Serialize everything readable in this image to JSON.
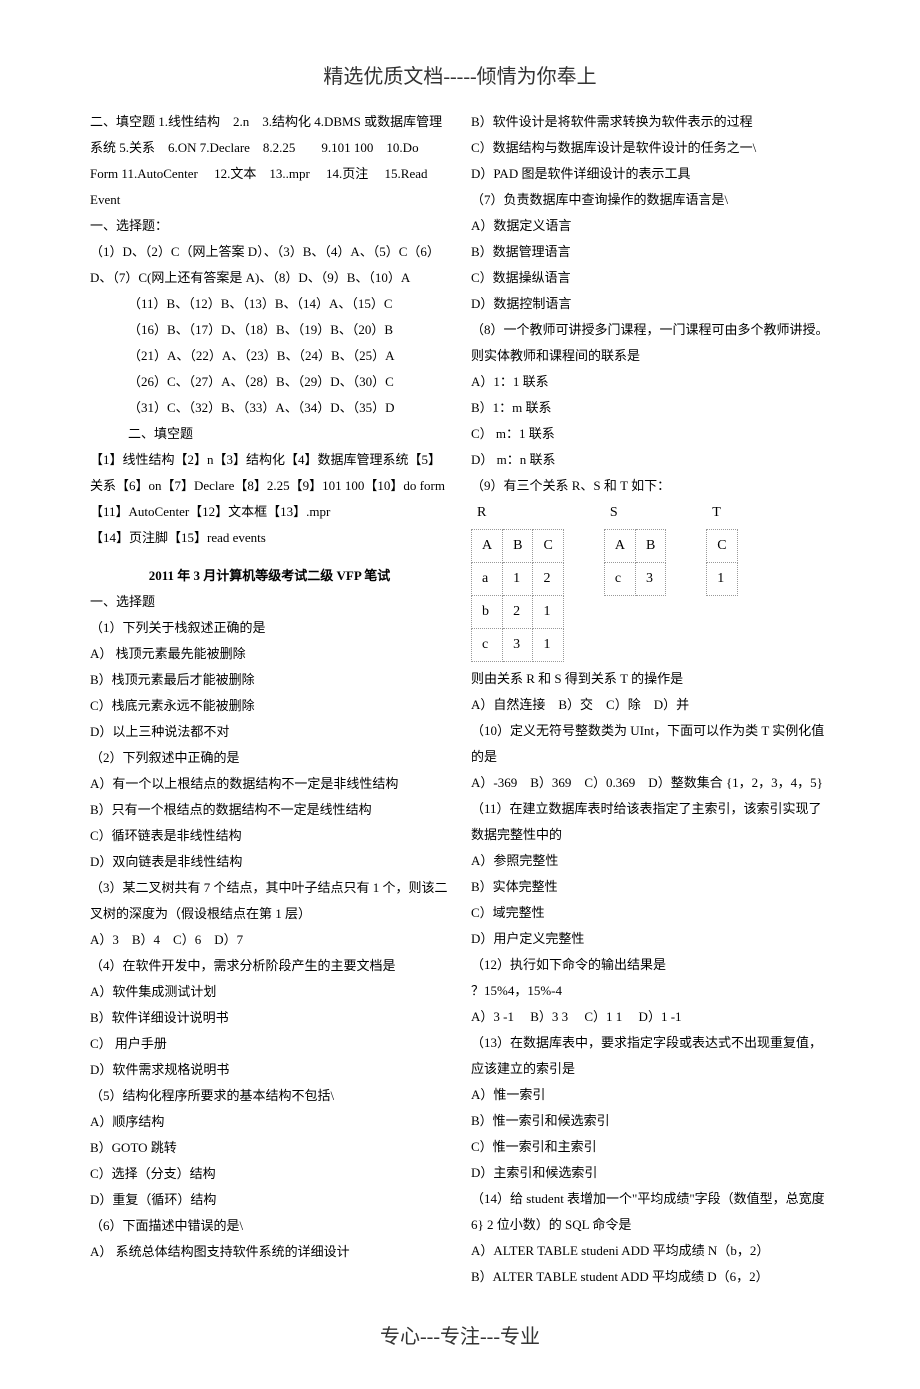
{
  "header": "精选优质文档-----倾情为你奉上",
  "footer": "专心---专注---专业",
  "left": {
    "p": [
      "二、填空题 1.线性结构　2.n　3.结构化 4.DBMS 或数据库管理系统 5.关系　6.ON 7.Declare　8.2.25　　9.101 100　10.Do Form 11.AutoCenter　 12.文本　13..mpr　 14.页注　 15.Read Event",
      "一、选择题：",
      "（1）D、（2）C（网上答案 D）、（3）B、（4）A、（5）C（6）D、（7）C(网上还有答案是 A)、（8）D、（9）B、（10）A"
    ],
    "indent": [
      "（11）B、（12）B、（13）B、（14）A、（15）C",
      "（16）B、（17）D、（18）B、（19）B、（20）B",
      "（21）A、（22）A、（23）B、（24）B、（25）A",
      "（26）C、（27）A、（28）B、（29）D、（30）C",
      "（31）C、（32）B、（33）A、（34）D、（35）D",
      "二、填空题"
    ],
    "p2": [
      "【1】线性结构【2】n【3】结构化【4】数据库管理系统【5】关系【6】on【7】Declare【8】2.25【9】101 100【10】do form【11】AutoCenter【12】文本框【13】.mpr",
      "【14】页注脚【15】read events"
    ],
    "title": "2011 年 3 月计算机等级考试二级 VFP 笔试",
    "section": "一、选择题",
    "q1": {
      "stem": "（1）下列关于栈叙述正确的是",
      "a": "A） 栈顶元素最先能被删除",
      "b": "B）栈顶元素最后才能被删除",
      "c": "C）栈底元素永远不能被删除",
      "d": "D）以上三种说法都不对"
    },
    "q2": {
      "stem": "（2）下列叙述中正确的是",
      "a": "A）有一个以上根结点的数据结构不一定是非线性结构",
      "b": "B）只有一个根结点的数据结构不一定是线性结构",
      "c": "C）循环链表是非线性结构",
      "d": "D）双向链表是非线性结构"
    },
    "q3": {
      "stem": "（3）某二叉树共有 7 个结点，其中叶子结点只有 1 个，则该二叉树的深度为（假设根结点在第 1 层）",
      "opts": "A）3　B）4　C）6　D）7"
    },
    "q4": {
      "stem": "（4）在软件开发中，需求分析阶段产生的主要文档是",
      "a": "A）软件集成测试计划",
      "b": "B）软件详细设计说明书",
      "c": "C） 用户手册",
      "d": "D）软件需求规格说明书"
    },
    "q5": {
      "stem": "（5）结构化程序所要求的基本结构不包括\\",
      "a": "A）顺序结构",
      "b": "B）GOTO 跳转",
      "c": "C）选择（分支）结构",
      "d": "D）重复（循环）结构"
    },
    "q6": {
      "stem": "（6）下面描述中错误的是\\",
      "a": "A） 系统总体结构图支持软件系统的详细设计"
    }
  },
  "right": {
    "q6": {
      "b": "B）软件设计是将软件需求转换为软件表示的过程",
      "c": "C）数据结构与数据库设计是软件设计的任务之一\\",
      "d": "D）PAD 图是软件详细设计的表示工具"
    },
    "q7": {
      "stem": "（7）负责数据库中查询操作的数据库语言是\\",
      "a": "A）数据定义语言",
      "b": "B）数据管理语言",
      "c": "C）数据操纵语言",
      "d": "D）数据控制语言"
    },
    "q8": {
      "stem": "（8）一个教师可讲授多门课程，一门课程可由多个教师讲授。则实体教师和课程间的联系是",
      "a": "A）1：1 联系",
      "b": "B）1：m 联系",
      "c": "C） m：1 联系",
      "d": "D） m：n 联系"
    },
    "q9": {
      "stem": "（9）有三个关系 R、S 和 T 如下：",
      "after": "则由关系 R 和 S 得到关系 T 的操作是",
      "opts": "A）自然连接　B）交　C）除　D）并"
    },
    "q10": {
      "stem": "（10）定义无符号整数类为 UInt，下面可以作为类 T 实例化值的是",
      "opts": "A）-369　B）369　C）0.369　D）整数集合 {1，2，3，4，5}"
    },
    "q11": {
      "stem": "（11）在建立数据库表时给该表指定了主索引，该索引实现了数据完整性中的",
      "a": "A）参照完整性",
      "b": "B）实体完整性",
      "c": "C）域完整性",
      "d": "D）用户定义完整性"
    },
    "q12": {
      "stem": "（12）执行如下命令的输出结果是",
      "line": "？15%4，15%-4",
      "opts": "A）3 -1　 B）3 3　 C）1 1　 D）1 -1"
    },
    "q13": {
      "stem": "（13）在数据库表中，要求指定字段或表达式不出现重复值，应该建立的索引是",
      "a": "A）惟一索引",
      "b": "B）惟一索引和候选索引",
      "c": "C）惟一索引和主索引",
      "d": "D）主索引和候选索引"
    },
    "q14": {
      "stem": "（14）给 student 表增加一个\"平均成绩\"字段（数值型，总宽度 6} 2 位小数）的 SQL 命令是",
      "a": "A）ALTER TABLE studeni ADD 平均成绩 N（b，2）",
      "b": "B）ALTER TABLE student ADD 平均成绩 D（6，2）"
    }
  },
  "chart_data": {
    "type": "table",
    "relations": [
      {
        "name": "R",
        "columns": [
          "A",
          "B",
          "C"
        ],
        "rows": [
          [
            "a",
            "1",
            "2"
          ],
          [
            "b",
            "2",
            "1"
          ],
          [
            "c",
            "3",
            "1"
          ]
        ]
      },
      {
        "name": "S",
        "columns": [
          "A",
          "B"
        ],
        "rows": [
          [
            "c",
            "3"
          ]
        ]
      },
      {
        "name": "T",
        "columns": [
          "C"
        ],
        "rows": [
          [
            "1"
          ]
        ]
      }
    ]
  }
}
